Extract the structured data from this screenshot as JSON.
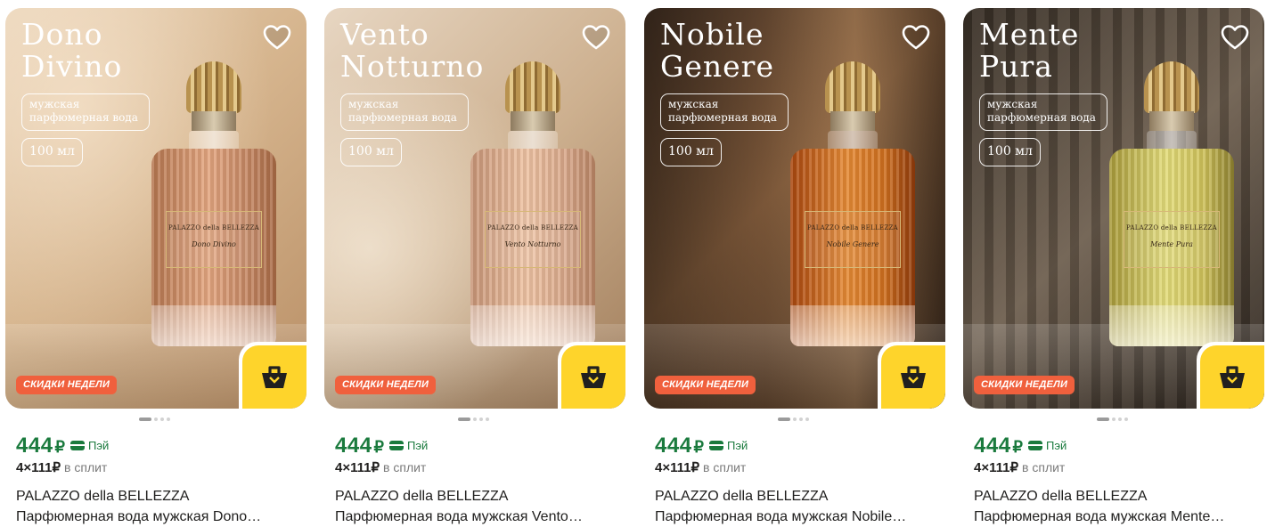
{
  "colors": {
    "price_green": "#1a7a3d",
    "badge_orange": "#f0603d",
    "cart_yellow": "#fed42b"
  },
  "icons": {
    "favorite": "heart-outline-icon",
    "cart": "basket-icon",
    "pay": "card-icon"
  },
  "products": [
    {
      "photo_title_line1": "Dono",
      "photo_title_line2": "Divino",
      "type_label": "мужская парфюмерная вода",
      "volume_label": "100 мл",
      "bottle_brand": "PALAZZO della BELLEZZA",
      "bottle_scent": "Dono Divino",
      "badge": "СКИДКИ НЕДЕЛИ",
      "price": "444",
      "currency": "₽",
      "pay_label": "Пэй",
      "split_amount": "4×111",
      "split_currency": "₽",
      "split_text": "в сплит",
      "brand": "PALAZZO della BELLEZZA",
      "name": "Парфюмерная вода мужская Dono…",
      "image_count": 4,
      "active_image": 1
    },
    {
      "photo_title_line1": "Vento",
      "photo_title_line2": "Notturno",
      "type_label": "мужская парфюмерная вода",
      "volume_label": "100 мл",
      "bottle_brand": "PALAZZO della BELLEZZA",
      "bottle_scent": "Vento Notturno",
      "badge": "СКИДКИ НЕДЕЛИ",
      "price": "444",
      "currency": "₽",
      "pay_label": "Пэй",
      "split_amount": "4×111",
      "split_currency": "₽",
      "split_text": "в сплит",
      "brand": "PALAZZO della BELLEZZA",
      "name": "Парфюмерная вода мужская Vento…",
      "image_count": 4,
      "active_image": 1
    },
    {
      "photo_title_line1": "Nobile",
      "photo_title_line2": "Genere",
      "type_label": "мужская парфюмерная вода",
      "volume_label": "100 мл",
      "bottle_brand": "PALAZZO della BELLEZZA",
      "bottle_scent": "Nobile Genere",
      "badge": "СКИДКИ НЕДЕЛИ",
      "price": "444",
      "currency": "₽",
      "pay_label": "Пэй",
      "split_amount": "4×111",
      "split_currency": "₽",
      "split_text": "в сплит",
      "brand": "PALAZZO della BELLEZZA",
      "name": "Парфюмерная вода мужская Nobile…",
      "image_count": 4,
      "active_image": 1
    },
    {
      "photo_title_line1": "Mente",
      "photo_title_line2": "Pura",
      "type_label": "мужская парфюмерная вода",
      "volume_label": "100 мл",
      "bottle_brand": "PALAZZO della BELLEZZA",
      "bottle_scent": "Mente Pura",
      "badge": "СКИДКИ НЕДЕЛИ",
      "price": "444",
      "currency": "₽",
      "pay_label": "Пэй",
      "split_amount": "4×111",
      "split_currency": "₽",
      "split_text": "в сплит",
      "brand": "PALAZZO della BELLEZZA",
      "name": "Парфюмерная вода мужская Mente…",
      "image_count": 4,
      "active_image": 1
    }
  ]
}
